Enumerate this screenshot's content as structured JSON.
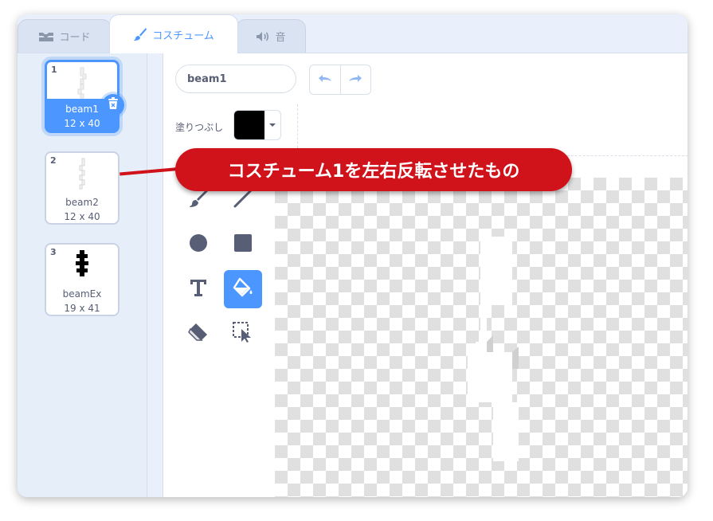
{
  "tabs": [
    {
      "label": "コード",
      "icon": "code-icon",
      "active": false
    },
    {
      "label": "コスチューム",
      "icon": "brush-icon",
      "active": true
    },
    {
      "label": "音",
      "icon": "speaker-icon",
      "active": false
    }
  ],
  "costumes": [
    {
      "number": "1",
      "name": "beam1",
      "size": "12 x 40",
      "selected": true
    },
    {
      "number": "2",
      "name": "beam2",
      "size": "12 x 40",
      "selected": false
    },
    {
      "number": "3",
      "name": "beamEx",
      "size": "19 x 41",
      "selected": false
    }
  ],
  "editor": {
    "costume_name": "beam1",
    "fill_label": "塗りつぶし",
    "fill_color": "#000000"
  },
  "tools": [
    "brush-tool",
    "line-tool",
    "circle-tool",
    "rectangle-tool",
    "text-tool",
    "fill-tool",
    "eraser-tool",
    "select-tool"
  ],
  "active_tool": "fill-tool",
  "annotation": {
    "text": "コスチューム1を左右反転させたもの"
  },
  "colors": {
    "accent": "#4c97ff",
    "callout": "#d0121b"
  }
}
